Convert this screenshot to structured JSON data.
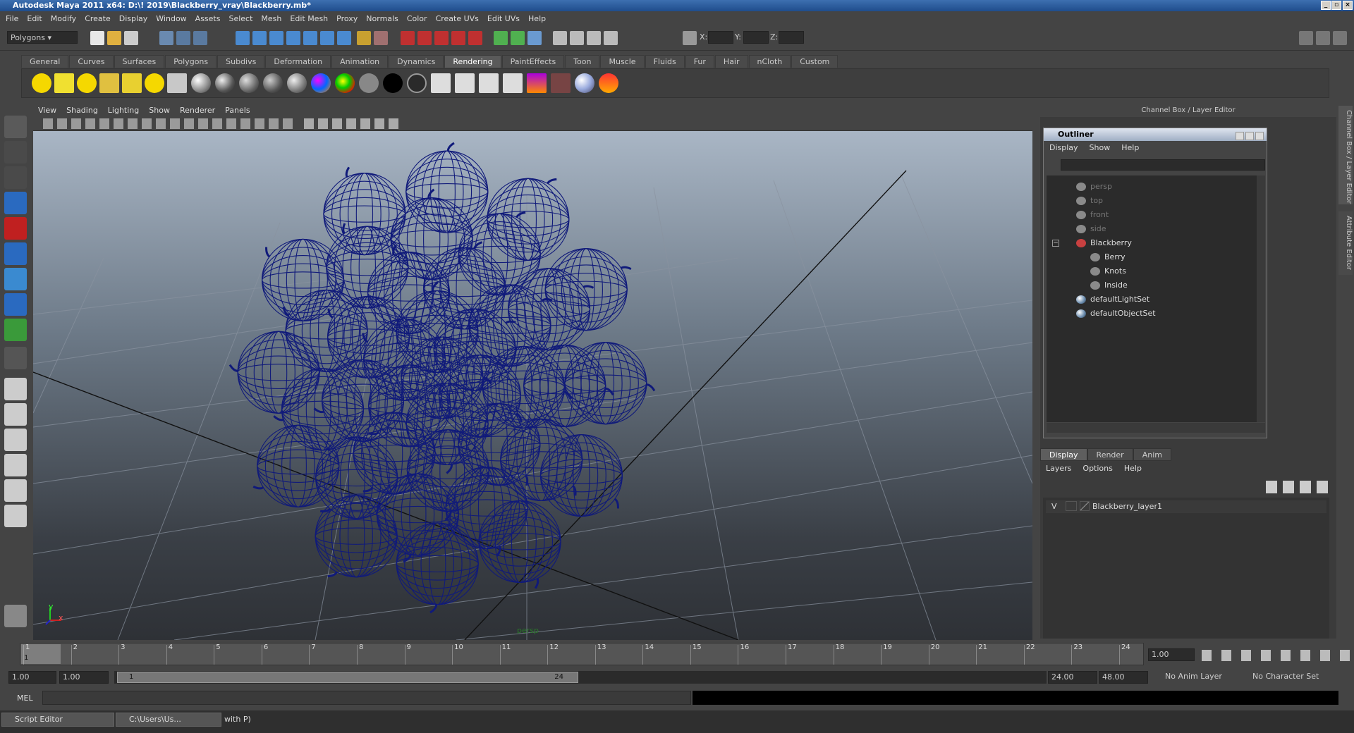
{
  "window": {
    "title": "Autodesk Maya 2011 x64: D:\\! 2019\\Blackberry_vray\\Blackberry.mb*"
  },
  "menubar": [
    "File",
    "Edit",
    "Modify",
    "Create",
    "Display",
    "Window",
    "Assets",
    "Select",
    "Mesh",
    "Edit Mesh",
    "Proxy",
    "Normals",
    "Color",
    "Create UVs",
    "Edit UVs",
    "Help"
  ],
  "statusline": {
    "mode": "Polygons",
    "x_label": "X:",
    "y_label": "Y:",
    "z_label": "Z:"
  },
  "shelf_tabs": [
    "General",
    "Curves",
    "Surfaces",
    "Polygons",
    "Subdivs",
    "Deformation",
    "Animation",
    "Dynamics",
    "Rendering",
    "PaintEffects",
    "Toon",
    "Muscle",
    "Fluids",
    "Fur",
    "Hair",
    "nCloth",
    "Custom"
  ],
  "shelf_active": "Rendering",
  "viewport": {
    "menu": [
      "View",
      "Shading",
      "Lighting",
      "Show",
      "Renderer",
      "Panels"
    ],
    "camera_label": "persp",
    "axis_y": "y",
    "axis_x": "x"
  },
  "channel_box": {
    "title": "Channel Box / Layer Editor",
    "side_tab1": "Channel Box / Layer Editor",
    "side_tab2": "Attribute Editor"
  },
  "outliner": {
    "title": "Outliner",
    "menu": [
      "Display",
      "Show",
      "Help"
    ],
    "items": [
      {
        "label": "persp",
        "dim": true,
        "indent": 0
      },
      {
        "label": "top",
        "dim": true,
        "indent": 0
      },
      {
        "label": "front",
        "dim": true,
        "indent": 0
      },
      {
        "label": "side",
        "dim": true,
        "indent": 0
      },
      {
        "label": "Blackberry",
        "dim": false,
        "indent": 0
      },
      {
        "label": "Berry",
        "dim": false,
        "indent": 1
      },
      {
        "label": "Knots",
        "dim": false,
        "indent": 1
      },
      {
        "label": "Inside",
        "dim": false,
        "indent": 1
      },
      {
        "label": "defaultLightSet",
        "dim": false,
        "indent": 0
      },
      {
        "label": "defaultObjectSet",
        "dim": false,
        "indent": 0
      }
    ]
  },
  "layer_editor": {
    "tabs": [
      "Display",
      "Render",
      "Anim"
    ],
    "active_tab": "Display",
    "menu": [
      "Layers",
      "Options",
      "Help"
    ],
    "layers": [
      {
        "visible": "V",
        "name": "Blackberry_layer1"
      }
    ]
  },
  "timeline": {
    "frames": [
      "1",
      "2",
      "3",
      "4",
      "5",
      "6",
      "7",
      "8",
      "9",
      "10",
      "11",
      "12",
      "13",
      "14",
      "15",
      "16",
      "17",
      "18",
      "19",
      "20",
      "21",
      "22",
      "23",
      "24"
    ],
    "current_frame_box": "1",
    "current_time": "1.00"
  },
  "range": {
    "start": "1.00",
    "playback_start": "1.00",
    "slider_left": "1",
    "slider_right": "24",
    "playback_end": "24.00",
    "end": "48.00",
    "anim_layer": "No Anim Layer",
    "character_set": "No Character Set"
  },
  "cmdline": {
    "label": "MEL"
  },
  "taskbar": [
    {
      "label": "Script Editor"
    },
    {
      "label": "C:\\Users\\Us..."
    },
    {
      "label": "with P)"
    }
  ]
}
